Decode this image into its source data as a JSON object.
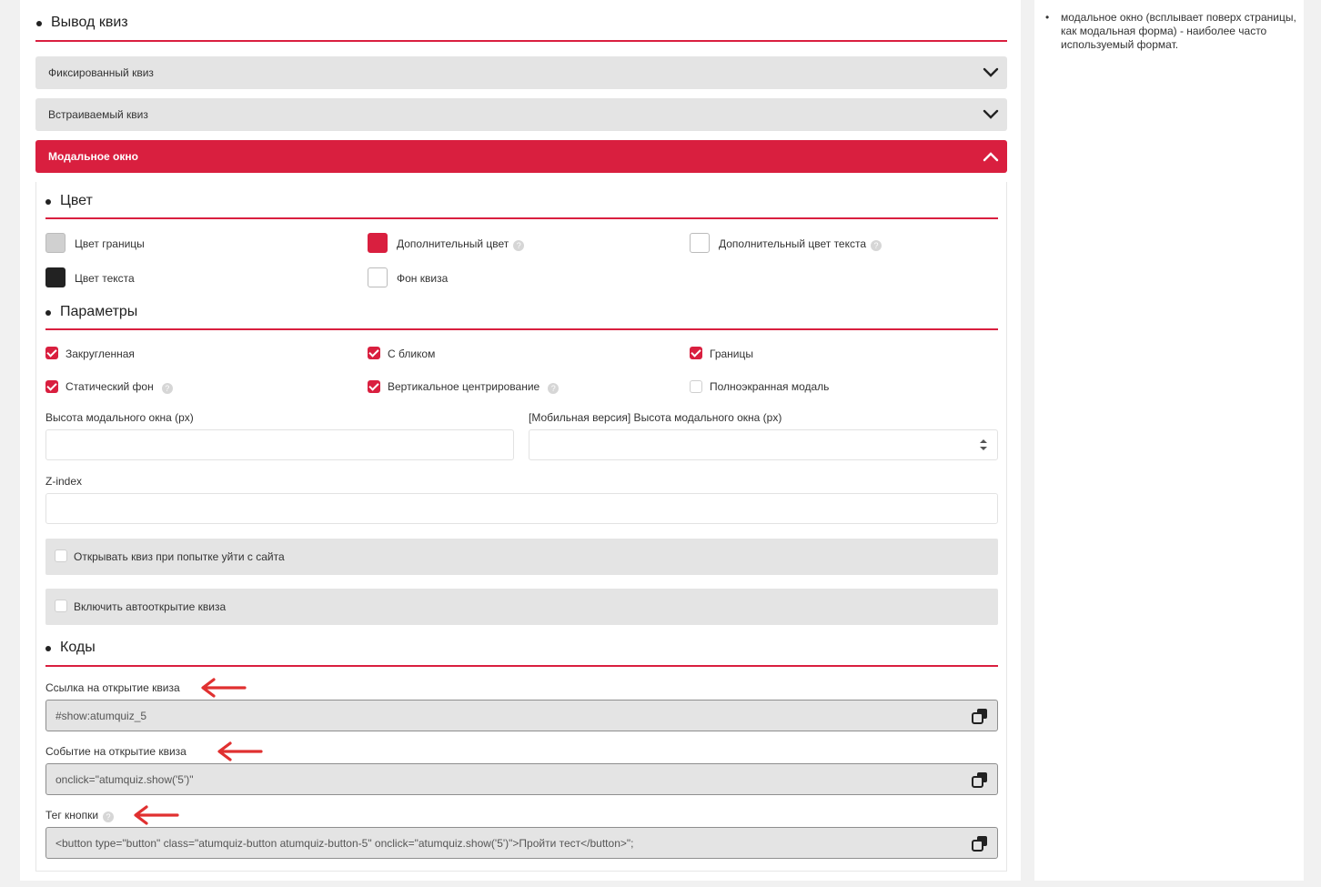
{
  "header": {
    "title": "Вывод квиз"
  },
  "accordions": [
    {
      "label": "Фиксированный квиз",
      "expanded": false
    },
    {
      "label": "Встраиваемый квиз",
      "expanded": false
    },
    {
      "label": "Модальное окно",
      "expanded": true
    }
  ],
  "colors": {
    "section_title": "Цвет",
    "accent": "#d91f3f",
    "items": [
      {
        "label": "Цвет границы",
        "swatch": "#d0d0d0"
      },
      {
        "label": "Дополнительный цвет",
        "swatch": "#d91f3f",
        "help": true
      },
      {
        "label": "Дополнительный цвет текста",
        "swatch": "#ffffff",
        "help": true
      },
      {
        "label": "Цвет текста",
        "swatch": "#222222"
      },
      {
        "label": "Фон квиза",
        "swatch": "#ffffff"
      }
    ]
  },
  "params": {
    "section_title": "Параметры",
    "checkboxes": [
      {
        "label": "Закругленная",
        "checked": true
      },
      {
        "label": "С бликом",
        "checked": true
      },
      {
        "label": "Границы",
        "checked": true
      },
      {
        "label": "Статический фон",
        "checked": true,
        "help": true
      },
      {
        "label": "Вертикальное центрирование",
        "checked": true,
        "help": true
      },
      {
        "label": "Полноэкранная модаль",
        "checked": false
      }
    ],
    "height_label": "Высота модального окна (px)",
    "height_value": "",
    "mobile_height_label": "[Мобильная версия] Высота модального окна (px)",
    "mobile_height_value": "",
    "zindex_label": "Z-index",
    "zindex_value": "",
    "exit_intent_label": "Открывать квиз при попытке уйти с сайта",
    "exit_intent_checked": false,
    "autoopen_label": "Включить автооткрытие квиза",
    "autoopen_checked": false
  },
  "codes": {
    "section_title": "Коды",
    "link_label": "Ссылка на открытие квиза",
    "link_value": "#show:atumquiz_5",
    "event_label": "Событие на открытие квиза",
    "event_value": "onclick=\"atumquiz.show('5')\"",
    "tag_label": "Тег кнопки",
    "tag_value": "<button type=\"button\" class=\"atumquiz-button atumquiz-button-5\" onclick=\"atumquiz.show('5')\">Пройти тест</button>\";"
  },
  "sidebar": {
    "notes": [
      "модальное окно (всплывает поверх страницы, как модальная форма) - наиболее часто используемый формат."
    ]
  }
}
